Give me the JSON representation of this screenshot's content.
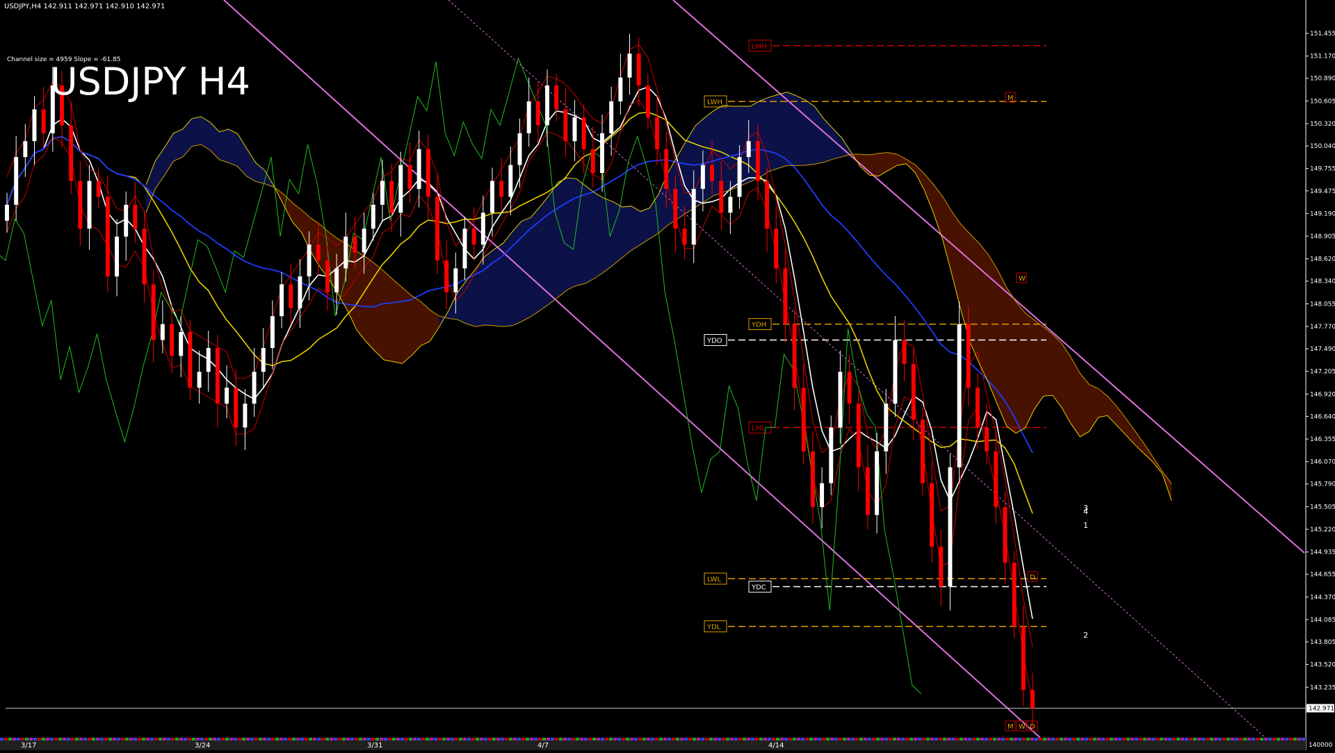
{
  "header": {
    "info": "USDJPY,H4  142.911 142.971 142.910 142.971",
    "channel": "Channel size = 4959 Slope = -61.85",
    "big_title": "USDJPY H4"
  },
  "colors": {
    "background": "#000000",
    "bull": "#ffffff",
    "bear": "#ff0000",
    "ma_white": "#ffffff",
    "ma_yellow": "#e8d000",
    "ma_blue": "#1f3cff",
    "chikou": "#1fbf1f",
    "envelope": "#cc0000",
    "channel": "#e070e0",
    "kumo_bear": "#cc3300",
    "kumo_bull": "#2233cc",
    "level_gold": "#e0a000"
  },
  "chart_data": {
    "type": "candlestick",
    "symbol": "USDJPY",
    "timeframe": "H4",
    "ylim": [
      142.6,
      151.7
    ],
    "x_tick_labels": [
      "3/17",
      "3/24",
      "3/31",
      "4/7",
      "4/14"
    ],
    "y_tick_labels": [
      "151.455",
      "151.170",
      "150.890",
      "150.605",
      "150.320",
      "150.040",
      "149.755",
      "149.475",
      "149.190",
      "148.905",
      "148.620",
      "148.340",
      "148.055",
      "147.770",
      "147.490",
      "147.205",
      "146.920",
      "146.640",
      "146.355",
      "146.070",
      "145.790",
      "145.505",
      "145.220",
      "144.935",
      "144.655",
      "144.370",
      "144.085",
      "143.805",
      "143.520",
      "143.235"
    ],
    "current_price": "142.971",
    "bottom_axis_value": "140000",
    "close": [
      149.3,
      149.9,
      150.1,
      150.5,
      150.2,
      150.8,
      150.3,
      149.6,
      149.0,
      149.6,
      149.4,
      148.4,
      148.9,
      149.3,
      149.0,
      148.3,
      147.6,
      147.8,
      147.4,
      147.7,
      147.0,
      147.2,
      147.5,
      146.8,
      147.0,
      146.5,
      146.8,
      147.2,
      147.5,
      147.9,
      148.3,
      148.0,
      148.4,
      148.8,
      148.6,
      148.2,
      148.5,
      148.9,
      148.7,
      149.0,
      149.3,
      149.6,
      149.2,
      149.8,
      149.5,
      150.0,
      149.4,
      148.6,
      148.2,
      148.5,
      149.0,
      148.8,
      149.2,
      149.6,
      149.4,
      149.8,
      150.2,
      150.6,
      150.3,
      150.8,
      150.5,
      150.1,
      150.4,
      150.0,
      149.7,
      150.2,
      150.6,
      150.9,
      151.2,
      150.8,
      150.4,
      150.0,
      149.5,
      149.0,
      148.8,
      149.5,
      149.8,
      149.6,
      149.2,
      149.4,
      149.9,
      150.1,
      149.6,
      149.0,
      148.5,
      147.8,
      147.0,
      146.2,
      145.5,
      145.8,
      146.5,
      147.2,
      146.8,
      146.0,
      145.4,
      146.2,
      146.8,
      147.6,
      147.3,
      146.6,
      145.8,
      145.0,
      144.5,
      146.0,
      147.8,
      147.0,
      146.5,
      146.2,
      145.5,
      144.8,
      144.0,
      143.2,
      142.97
    ],
    "levels": [
      {
        "label": "LMH",
        "value": 151.3
      },
      {
        "label": "LWH",
        "value": 150.6
      },
      {
        "label": "YDH",
        "value": 147.8
      },
      {
        "label": "YDO",
        "value": 147.6
      },
      {
        "label": "LML",
        "value": 146.5
      },
      {
        "label": "LWL",
        "value": 144.6
      },
      {
        "label": "YDC",
        "value": 144.5
      },
      {
        "label": "YDL",
        "value": 144.0
      }
    ],
    "small_markers": [
      "M",
      "W",
      "M",
      "W",
      "D",
      "D"
    ],
    "projection_labels": [
      "3",
      "4",
      "1",
      "2"
    ]
  }
}
